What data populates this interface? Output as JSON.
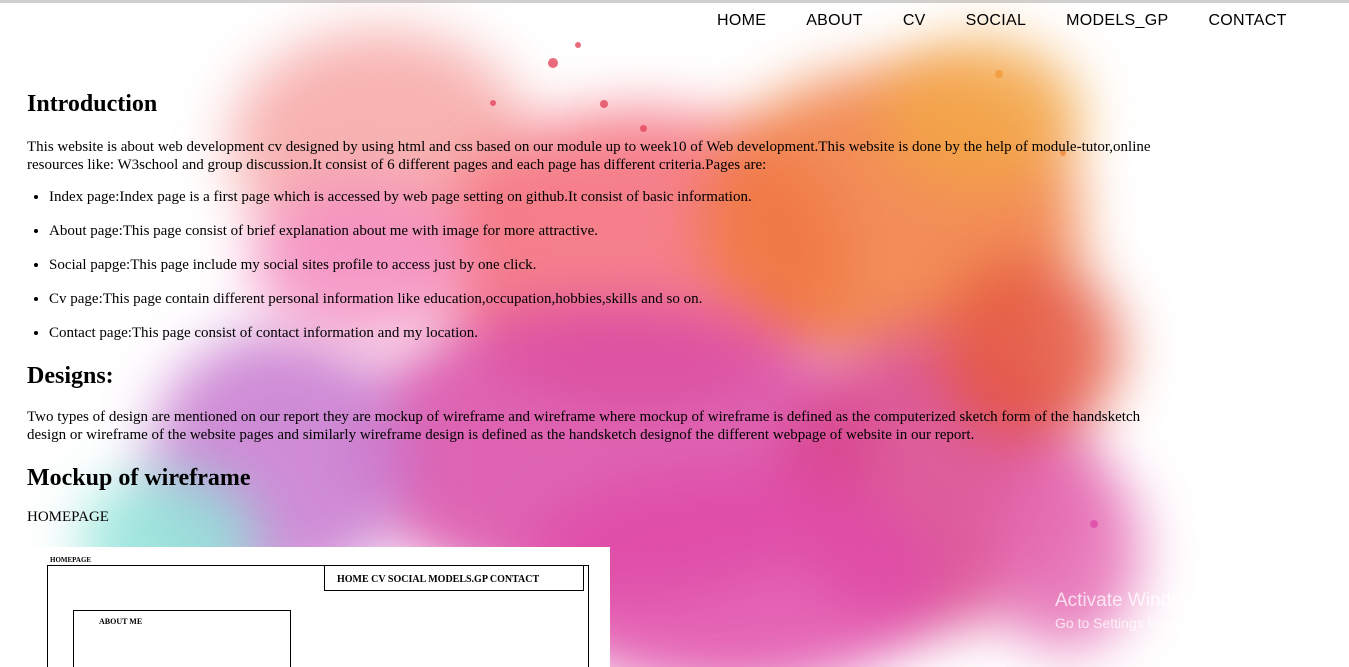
{
  "nav": {
    "items": [
      {
        "label": "HOME"
      },
      {
        "label": "ABOUT"
      },
      {
        "label": "CV"
      },
      {
        "label": "SOCIAL"
      },
      {
        "label": "MODELS_GP"
      },
      {
        "label": "CONTACT"
      }
    ]
  },
  "intro": {
    "heading": "Introduction",
    "paragraph": "This website is about web development cv designed by using html and css based on our module up to week10 of Web development.This website is done by the help of module-tutor,online resources like: W3school and group discussion.It consist of 6 different pages and each page has different criteria.Pages are:",
    "items": [
      "Index page:Index page is a first page which is accessed by web page setting on github.It consist of basic information.",
      "About page:This page consist of brief explanation about me with image for more attractive.",
      "Social papge:This page include my social sites profile to access just by one click.",
      "Cv page:This page contain different personal information like education,occupation,hobbies,skills and so on.",
      "Contact page:This page consist of contact information and my location."
    ]
  },
  "designs": {
    "heading": "Designs:",
    "paragraph": "Two types of design are mentioned on our report they are mockup of wireframe and wireframe where mockup of wireframe is defined as the computerized sketch form of the handsketch design or wireframe of the website pages and similarly wireframe design is defined as the handsketch designof the different webpage of website in our report."
  },
  "mockup": {
    "heading": "Mockup of wireframe",
    "label": "HOMEPAGE",
    "image": {
      "title": "HOMEPAGE",
      "nav_text": "HOME CV SOCIAL MODELS.GP CONTACT",
      "box_label": "ABOUT ME"
    }
  },
  "watermark": {
    "line1": "Activate Windows",
    "line2": "Go to Settings to activate Windows."
  }
}
